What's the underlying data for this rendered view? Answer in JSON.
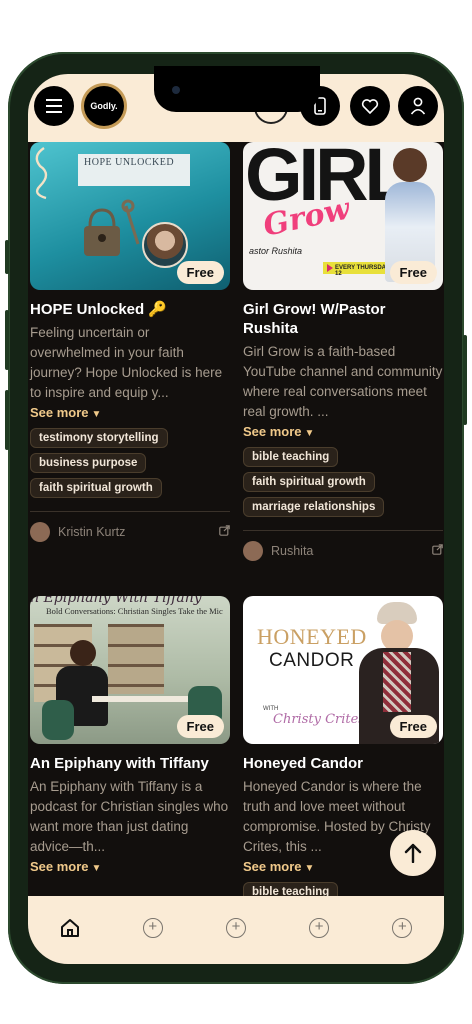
{
  "header": {
    "logo_text": "Godly."
  },
  "cards": [
    {
      "title": "HOPE Unlocked 🔑",
      "description": "Feeling uncertain or overwhelmed in your faith journey? Hope Unlocked is here to inspire and equip y...",
      "see_more": "See more",
      "badge": "Free",
      "cover_title": "HOPE UNLOCKED",
      "tags": [
        "testimony storytelling",
        "business purpose",
        "faith spiritual growth"
      ],
      "author": "Kristin Kurtz"
    },
    {
      "title": "Girl Grow! W/Pastor Rushita",
      "description": "Girl Grow is a faith-based YouTube channel and community where real conversations meet real growth. ...",
      "see_more": "See more",
      "badge": "Free",
      "cover_title": "GIRL",
      "cover_script": "Grow",
      "cover_sub": "astor Rushita",
      "cover_banner": "EVERY THURSDAY 12",
      "tags": [
        "bible teaching",
        "faith spiritual growth",
        "marriage relationships"
      ],
      "author": "Rushita"
    },
    {
      "title": "An Epiphany with Tiffany",
      "description": "An Epiphany with Tiffany is a podcast for Christian singles who want more than just dating advice—th...",
      "see_more": "See more",
      "badge": "Free",
      "cover_title": "An Epiphany With Tiffany",
      "cover_sub": "Bold Conversations: Christian Singles Take the Mic",
      "tags": [],
      "author": ""
    },
    {
      "title": "Honeyed Candor",
      "description": "Honeyed Candor is where the truth and love meet without compromise. Hosted by Christy Crites, this ...",
      "see_more": "See more",
      "badge": "Free",
      "cover_title": "HONEYED",
      "cover_title2": "CANDOR",
      "cover_with": "WITH",
      "cover_host": "Christy Crites",
      "tags": [
        "bible teaching"
      ],
      "author": ""
    }
  ],
  "colors": {
    "background": "#120f0d",
    "cream": "#faebd6",
    "accent": "#f0c98a"
  }
}
